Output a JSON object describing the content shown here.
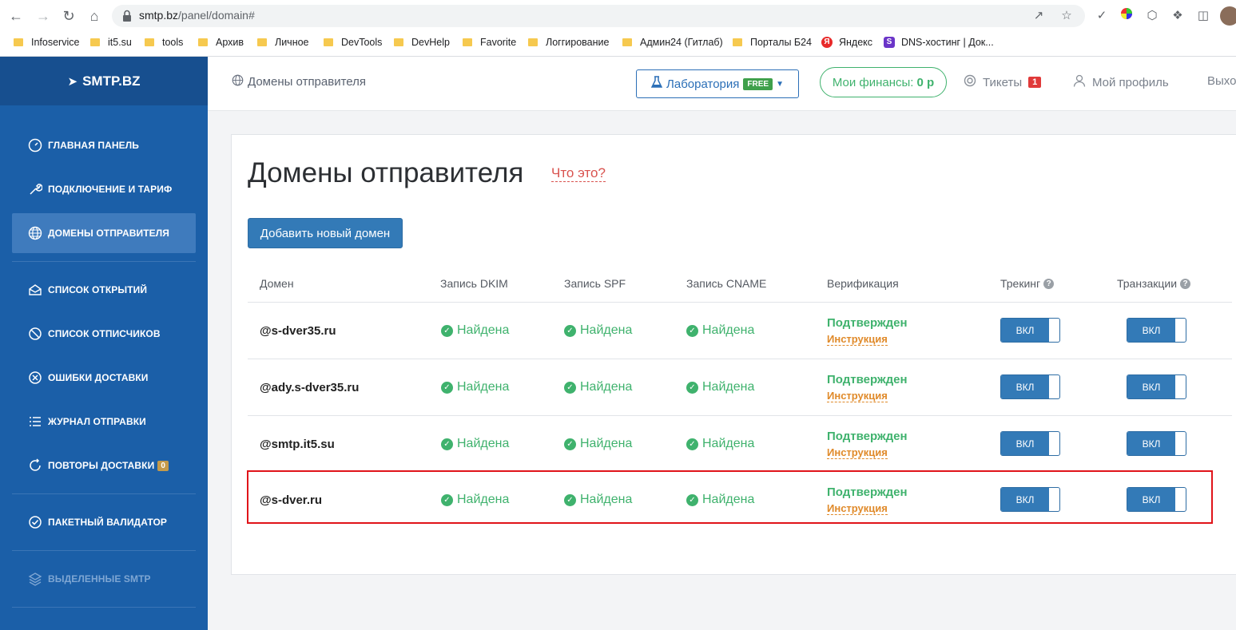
{
  "browser": {
    "url_host": "smtp.bz",
    "url_path": "/panel/domain#",
    "bookmarks": [
      {
        "label": "Infoservice",
        "icon": "folder"
      },
      {
        "label": "it5.su",
        "icon": "folder"
      },
      {
        "label": "tools",
        "icon": "folder"
      },
      {
        "label": "Архив",
        "icon": "folder"
      },
      {
        "label": "Личное",
        "icon": "folder"
      },
      {
        "label": "DevTools",
        "icon": "folder"
      },
      {
        "label": "DevHelp",
        "icon": "folder"
      },
      {
        "label": "Favorite",
        "icon": "folder"
      },
      {
        "label": "Логгирование",
        "icon": "folder"
      },
      {
        "label": "Админ24 (Гитлаб)",
        "icon": "folder"
      },
      {
        "label": "Порталы Б24",
        "icon": "folder"
      },
      {
        "label": "Яндекс",
        "icon": "yandex"
      },
      {
        "label": "DNS-хостинг | Док...",
        "icon": "s"
      }
    ]
  },
  "sidebar": {
    "logo": "SMTP.BZ",
    "items": [
      {
        "label": "ГЛАВНАЯ ПАНЕЛЬ",
        "icon": "dashboard-icon"
      },
      {
        "label": "ПОДКЛЮЧЕНИЕ И ТАРИФ",
        "icon": "wrench-icon"
      },
      {
        "label": "ДОМЕНЫ ОТПРАВИТЕЛЯ",
        "icon": "globe-icon",
        "active": true
      },
      {
        "label": "СПИСОК ОТКРЫТИЙ",
        "icon": "envelope-open-icon"
      },
      {
        "label": "СПИСОК ОТПИСЧИКОВ",
        "icon": "ban-icon"
      },
      {
        "label": "ОШИБКИ ДОСТАВКИ",
        "icon": "x-circle-icon"
      },
      {
        "label": "ЖУРНАЛ ОТПРАВКИ",
        "icon": "list-icon"
      },
      {
        "label": "ПОВТОРЫ ДОСТАВКИ",
        "icon": "refresh-icon",
        "badge": "0"
      },
      {
        "label": "ПАКЕТНЫЙ ВАЛИДАТОР",
        "icon": "check-circle-icon"
      },
      {
        "label": "ВЫДЕЛЕННЫЕ SMTP",
        "icon": "layers-icon",
        "disabled": true
      }
    ]
  },
  "header": {
    "breadcrumb": "Домены отправителя",
    "lab_label": "Лаборатория",
    "lab_badge": "FREE",
    "finance_label": "Мои финансы:",
    "finance_value": "0 р",
    "tickets_label": "Тикеты",
    "tickets_count": "1",
    "profile_label": "Мой профиль",
    "logout_label": "Выхо"
  },
  "main": {
    "title": "Домены отправителя",
    "whatis": "Что это?",
    "add_button": "Добавить новый домен",
    "columns": [
      "Домен",
      "Запись DKIM",
      "Запись SPF",
      "Запись CNAME",
      "Верификация",
      "Трекинг",
      "Транзакции"
    ],
    "rows": [
      {
        "domain": "@s-dver35.ru",
        "dkim": "Найдена",
        "spf": "Найдена",
        "cname": "Найдена",
        "verification": "Подтвержден",
        "instruction": "Инструкция",
        "tracking": "ВКЛ",
        "transactions": "ВКЛ"
      },
      {
        "domain": "@ady.s-dver35.ru",
        "dkim": "Найдена",
        "spf": "Найдена",
        "cname": "Найдена",
        "verification": "Подтвержден",
        "instruction": "Инструкция",
        "tracking": "ВКЛ",
        "transactions": "ВКЛ"
      },
      {
        "domain": "@smtp.it5.su",
        "dkim": "Найдена",
        "spf": "Найдена",
        "cname": "Найдена",
        "verification": "Подтвержден",
        "instruction": "Инструкция",
        "tracking": "ВКЛ",
        "transactions": "ВКЛ"
      },
      {
        "domain": "@s-dver.ru",
        "dkim": "Найдена",
        "spf": "Найдена",
        "cname": "Найдена",
        "verification": "Подтвержден",
        "instruction": "Инструкция",
        "tracking": "ВКЛ",
        "transactions": "ВКЛ"
      }
    ]
  },
  "colors": {
    "sidebar_bg": "#1b5fa8",
    "primary": "#337ab7",
    "success": "#3fb26d",
    "warning": "#e08a2a",
    "highlight": "#e0141a"
  }
}
